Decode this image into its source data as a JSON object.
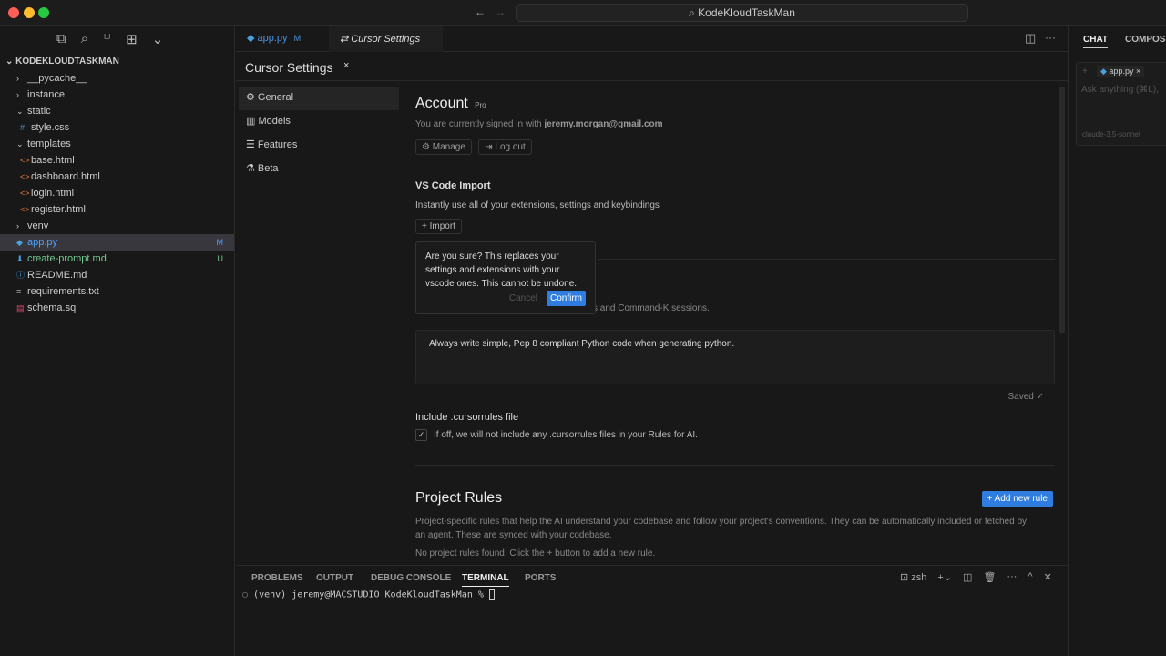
{
  "titlebar": {
    "search": "KodeKloudTaskMan",
    "back": "←",
    "forward": "→"
  },
  "explorer": {
    "root": "KODEKLOUDTASKMAN",
    "items": [
      {
        "label": "__pycache__",
        "type": "folder",
        "depth": 1,
        "chev": "›"
      },
      {
        "label": "instance",
        "type": "folder",
        "depth": 1,
        "chev": "›"
      },
      {
        "label": "static",
        "type": "folder",
        "depth": 1,
        "chev": "⌄"
      },
      {
        "label": "style.css",
        "type": "file",
        "depth": 2,
        "icon": "#",
        "iconColor": "#4a9fdd"
      },
      {
        "label": "templates",
        "type": "folder",
        "depth": 1,
        "chev": "⌄"
      },
      {
        "label": "base.html",
        "type": "file",
        "depth": 2,
        "icon": "<>",
        "iconColor": "#e37933"
      },
      {
        "label": "dashboard.html",
        "type": "file",
        "depth": 2,
        "icon": "<>",
        "iconColor": "#e37933"
      },
      {
        "label": "login.html",
        "type": "file",
        "depth": 2,
        "icon": "<>",
        "iconColor": "#e37933"
      },
      {
        "label": "register.html",
        "type": "file",
        "depth": 2,
        "icon": "<>",
        "iconColor": "#e37933"
      },
      {
        "label": "venv",
        "type": "folder",
        "depth": 1,
        "chev": "›"
      },
      {
        "label": "app.py",
        "type": "file",
        "depth": 1,
        "icon": "◆",
        "iconColor": "#4a9fdd",
        "badge": "M",
        "selected": true
      },
      {
        "label": "create-prompt.md",
        "type": "file",
        "depth": 1,
        "icon": "⬇",
        "iconColor": "#4a9fdd",
        "badge": "U",
        "color": "#73c991"
      },
      {
        "label": "README.md",
        "type": "file",
        "depth": 1,
        "icon": "ⓘ",
        "iconColor": "#4a9fdd"
      },
      {
        "label": "requirements.txt",
        "type": "file",
        "depth": 1,
        "icon": "≡",
        "iconColor": "#aaa"
      },
      {
        "label": "schema.sql",
        "type": "file",
        "depth": 1,
        "icon": "▤",
        "iconColor": "#e04a6a"
      }
    ]
  },
  "tabs": [
    {
      "label": "app.py",
      "badge": "M"
    },
    {
      "label": "Cursor Settings",
      "close": "×"
    }
  ],
  "settings": {
    "title": "Cursor Settings",
    "nav": [
      "General",
      "Models",
      "Features",
      "Beta"
    ],
    "account": {
      "title": "Account",
      "badge": "Pro",
      "signed_prefix": "You are currently signed in with ",
      "email": "jeremy.morgan@gmail.com",
      "manage": "Manage",
      "logout": "Log out"
    },
    "vscode": {
      "title": "VS Code Import",
      "desc": "Instantly use all of your extensions, settings and keybindings",
      "import": "Import"
    },
    "popup": {
      "text": "Are you sure? This replaces your settings and extensions with your vscode ones. This cannot be undone.",
      "cancel": "Cancel",
      "confirm": "Confirm"
    },
    "rules_desc_tail": "s and Command-K sessions.",
    "rules_text": "Always write simple, Pep 8 compliant Python code when generating python.",
    "saved": "Saved ✓",
    "cursorrules": {
      "title": "Include .cursorrules file",
      "desc": "If off, we will not include any .cursorrules files in your Rules for AI.",
      "checked": true
    },
    "project": {
      "title": "Project Rules",
      "add": "+ Add new rule",
      "desc": "Project-specific rules that help the AI understand your codebase and follow your project's conventions. They can be automatically included or fetched by an agent. These are synced with your codebase.",
      "empty": "No project rules found. Click the + button to add a new rule."
    }
  },
  "panel": {
    "tabs": [
      "PROBLEMS",
      "OUTPUT",
      "DEBUG CONSOLE",
      "TERMINAL",
      "PORTS"
    ],
    "shell": "zsh",
    "prompt": "(venv) jeremy@MACSTUDIO KodeKloudTaskMan % "
  },
  "chat": {
    "tabs": [
      "CHAT",
      "COMPOSER"
    ],
    "chip": "app.py",
    "placeholder": "Ask anything (⌘L),",
    "model": "claude-3.5-sonnet"
  },
  "colors": {
    "accent": "#2f7de1"
  }
}
